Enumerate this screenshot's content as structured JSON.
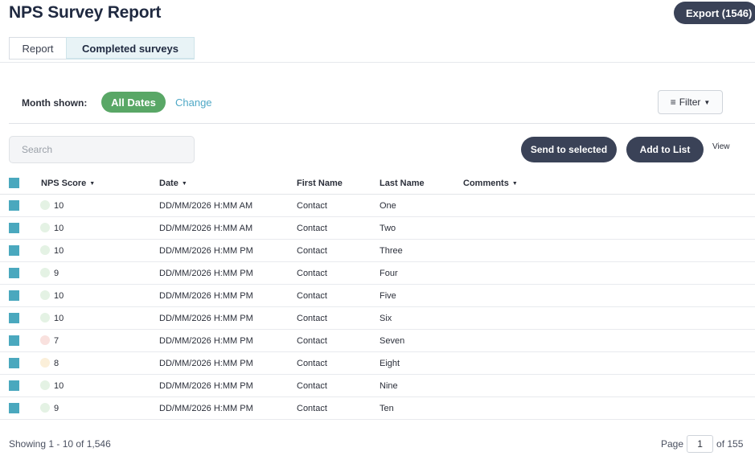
{
  "header": {
    "title": "NPS Survey Report",
    "export_label": "Export (1546)"
  },
  "tabs": [
    {
      "label": "Report",
      "active": false
    },
    {
      "label": "Completed surveys",
      "active": true
    }
  ],
  "filters": {
    "month_label": "Month shown:",
    "month_value": "All Dates",
    "change_label": "Change",
    "filter_label": "Filter"
  },
  "toolbar": {
    "search_placeholder": "Search",
    "send_label": "Send to selected",
    "add_label": "Add to List",
    "view_label": "View"
  },
  "table": {
    "columns": [
      "NPS Score",
      "Date",
      "First Name",
      "Last Name",
      "Comments"
    ],
    "rows": [
      {
        "score": "10",
        "date": "DD/MM/2026 H:MM AM",
        "first": "Contact",
        "last": "One",
        "comments": ""
      },
      {
        "score": "10",
        "date": "DD/MM/2026 H:MM AM",
        "first": "Contact",
        "last": "Two",
        "comments": ""
      },
      {
        "score": "10",
        "date": "DD/MM/2026 H:MM PM",
        "first": "Contact",
        "last": "Three",
        "comments": ""
      },
      {
        "score": "9",
        "date": "DD/MM/2026 H:MM PM",
        "first": "Contact",
        "last": "Four",
        "comments": ""
      },
      {
        "score": "10",
        "date": "DD/MM/2026 H:MM PM",
        "first": "Contact",
        "last": "Five",
        "comments": ""
      },
      {
        "score": "10",
        "date": "DD/MM/2026 H:MM PM",
        "first": "Contact",
        "last": "Six",
        "comments": ""
      },
      {
        "score": "7",
        "date": "DD/MM/2026 H:MM PM",
        "first": "Contact",
        "last": "Seven",
        "comments": ""
      },
      {
        "score": "8",
        "date": "DD/MM/2026 H:MM PM",
        "first": "Contact",
        "last": "Eight",
        "comments": ""
      },
      {
        "score": "10",
        "date": "DD/MM/2026 H:MM PM",
        "first": "Contact",
        "last": "Nine",
        "comments": ""
      },
      {
        "score": "9",
        "date": "DD/MM/2026 H:MM PM",
        "first": "Contact",
        "last": "Ten",
        "comments": ""
      }
    ]
  },
  "footer": {
    "showing": "Showing 1 - 10 of 1,546",
    "page_label": "Page",
    "page_value": "1",
    "of_pages": "of 155"
  },
  "colors": {
    "primary_button": "#3a4257",
    "accent": "#4aa8be",
    "all_dates": "#59a766",
    "promoter_dot": "#e4f2e4",
    "passive_dot": "#fbefd9",
    "detractor_dot": "#f9e1de"
  }
}
